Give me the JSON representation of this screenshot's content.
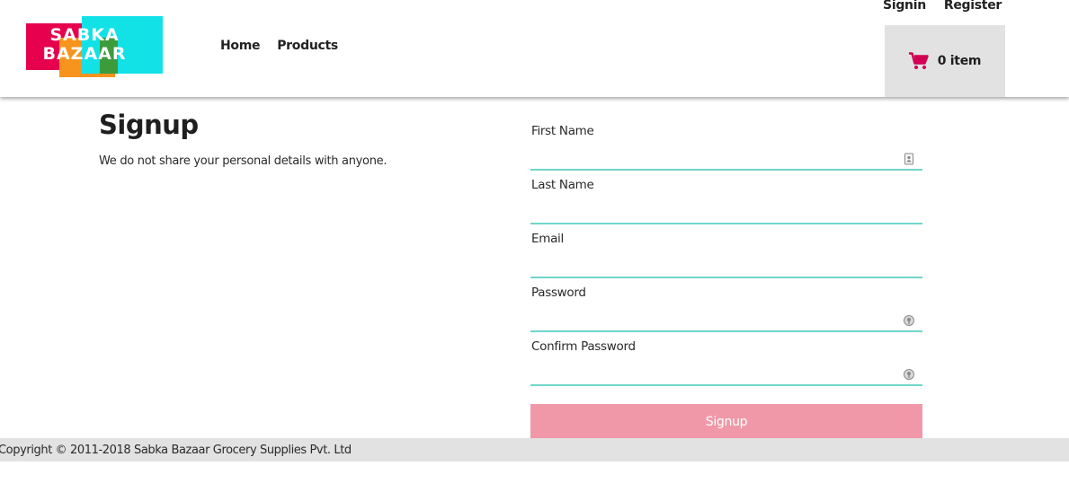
{
  "brand": {
    "logo_line1": "SABKA",
    "logo_line2": "BAZAAR",
    "colors": {
      "red": "#e6004d",
      "orange": "#f7941d",
      "green": "#3c9c3c",
      "cyan": "#12e1e6"
    }
  },
  "nav": {
    "home": "Home",
    "products": "Products"
  },
  "auth": {
    "signin": "Signin",
    "register": "Register"
  },
  "cart": {
    "icon": "cart-icon",
    "label": "0 item",
    "icon_color": "#d10052"
  },
  "intro": {
    "title": "Signup",
    "subtitle": "We do not share your personal details with anyone."
  },
  "form": {
    "fields": [
      {
        "label": "First Name",
        "icon": "contact-card-icon"
      },
      {
        "label": "Last Name"
      },
      {
        "label": "Email"
      },
      {
        "label": "Password",
        "icon": "key-icon"
      },
      {
        "label": "Confirm Password",
        "icon": "key-icon"
      }
    ],
    "submit": "Signup",
    "accent": "#6fd6cb",
    "button_color": "#f098a7"
  },
  "footer": {
    "copyright": "Copyright © 2011-2018 Sabka Bazaar Grocery Supplies Pvt. Ltd"
  }
}
